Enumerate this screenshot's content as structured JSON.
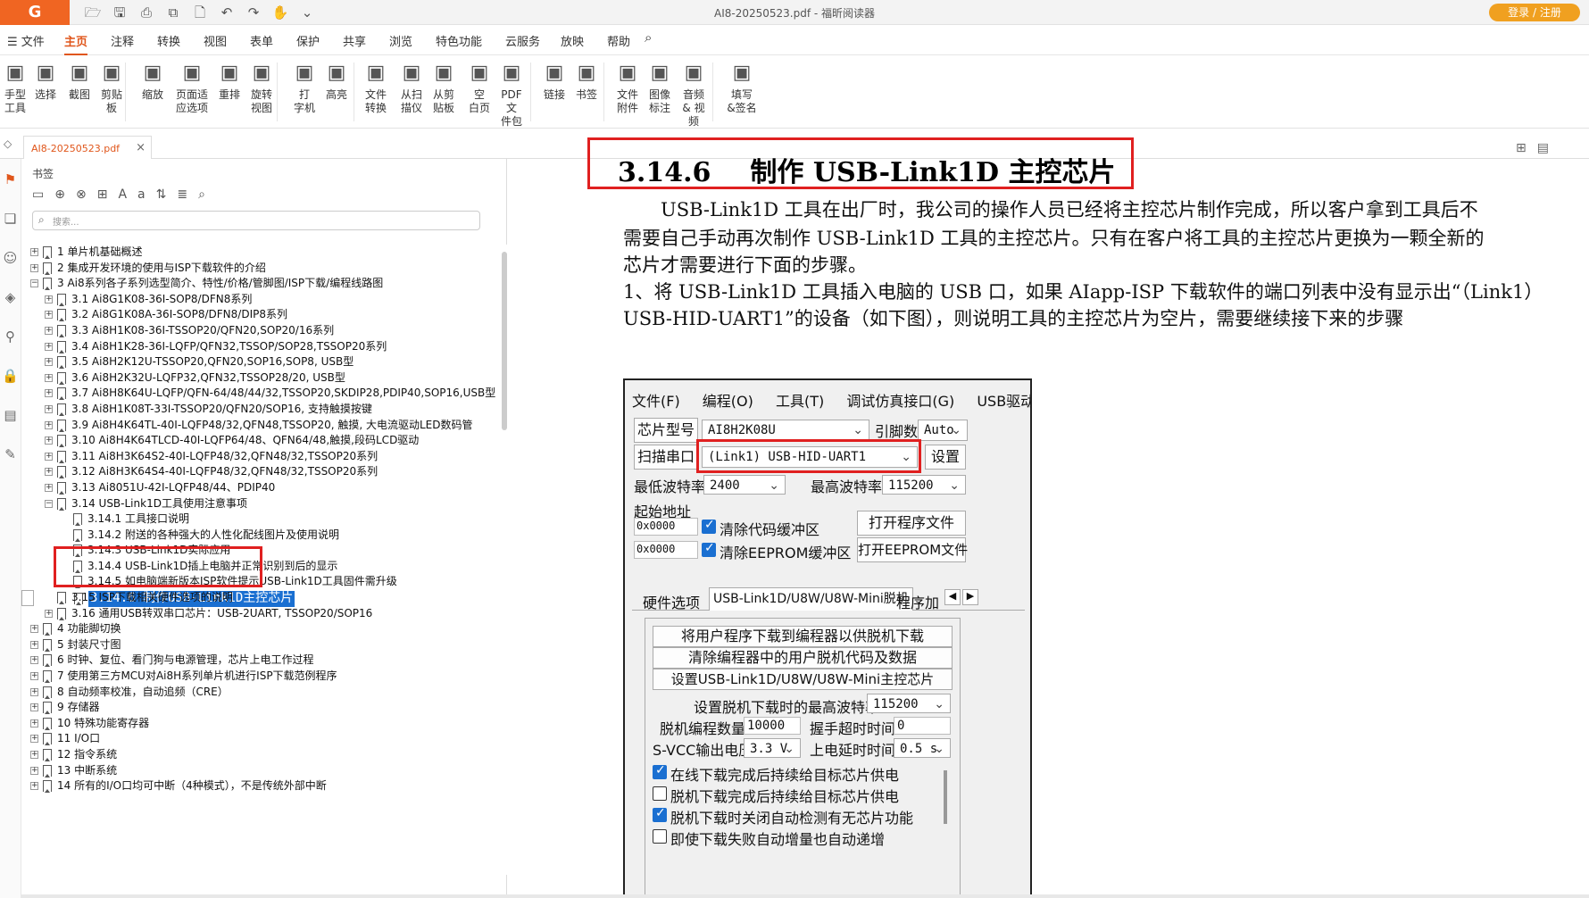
{
  "app": {
    "window_title": "AI8-20250523.pdf - 福昕阅读器",
    "login_label": "登录 / 注册",
    "logo": "G"
  },
  "menubar": {
    "file": "文件",
    "tabs": [
      "主页",
      "注释",
      "转换",
      "视图",
      "表单",
      "保护",
      "共享",
      "浏览",
      "特色功能",
      "云服务",
      "放映",
      "帮助"
    ]
  },
  "ribbon": {
    "tools": [
      {
        "label": "手型\n工具",
        "icon": "hand-icon"
      },
      {
        "label": "选择",
        "icon": "select-text-icon"
      },
      {
        "label": "截图",
        "icon": "screenshot-icon"
      },
      {
        "label": "剪贴\n板",
        "icon": "clipboard-icon"
      },
      {
        "label": "缩放",
        "icon": "zoom-icon"
      },
      {
        "label": "页面适\n应选项",
        "icon": "fit-page-icon"
      },
      {
        "label": "重排",
        "icon": "reflow-icon"
      },
      {
        "label": "旋转\n视图",
        "icon": "rotate-icon"
      },
      {
        "label": "打\n字机",
        "icon": "typewriter-icon"
      },
      {
        "label": "高亮",
        "icon": "highlight-icon"
      },
      {
        "label": "文件\n转换",
        "icon": "convert-icon"
      },
      {
        "label": "从扫\n描仪",
        "icon": "scanner-icon"
      },
      {
        "label": "从剪\n贴板",
        "icon": "from-clipboard-icon"
      },
      {
        "label": "空\n白页",
        "icon": "blank-page-icon"
      },
      {
        "label": "PDF文\n件包",
        "icon": "pdf-package-icon"
      },
      {
        "label": "链接",
        "icon": "link-icon"
      },
      {
        "label": "书签",
        "icon": "bookmark-icon"
      },
      {
        "label": "文件\n附件",
        "icon": "attachment-icon"
      },
      {
        "label": "图像\n标注",
        "icon": "image-annotation-icon"
      },
      {
        "label": "音频\n& 视频",
        "icon": "av-icon"
      },
      {
        "label": "填写\n&签名",
        "icon": "sign-icon"
      }
    ]
  },
  "tab": {
    "name": "AI8-20250523.pdf",
    "close": "×"
  },
  "bookmarks": {
    "title": "书签",
    "search_placeholder": "搜索...",
    "items": [
      {
        "level": 0,
        "expander": "+",
        "label": "1 单片机基础概述"
      },
      {
        "level": 0,
        "expander": "+",
        "label": "2 集成开发环境的使用与ISP下载软件的介绍"
      },
      {
        "level": 0,
        "expander": "−",
        "label": "3 Ai8系列各子系列选型简介、特性/价格/管脚图/ISP下载/编程线路图"
      },
      {
        "level": 1,
        "expander": "+",
        "label": "3.1 Ai8G1K08-36I-SOP8/DFN8系列"
      },
      {
        "level": 1,
        "expander": "+",
        "label": "3.2  Ai8G1K08A-36I-SOP8/DFN8/DIP8系列"
      },
      {
        "level": 1,
        "expander": "+",
        "label": "3.3 Ai8H1K08-36I-TSSOP20/QFN20,SOP20/16系列"
      },
      {
        "level": 1,
        "expander": "+",
        "label": "3.4 Ai8H1K28-36I-LQFP/QFN32,TSSOP/SOP28,TSSOP20系列"
      },
      {
        "level": 1,
        "expander": "+",
        "label": "3.5 Ai8H2K12U-TSSOP20,QFN20,SOP16,SOP8, USB型"
      },
      {
        "level": 1,
        "expander": "+",
        "label": "3.6 Ai8H2K32U-LQFP32,QFN32,TSSOP28/20, USB型"
      },
      {
        "level": 1,
        "expander": "+",
        "label": "3.7 Ai8H8K64U-LQFP/QFN-64/48/44/32,TSSOP20,SKDIP28,PDIP40,SOP16,USB型"
      },
      {
        "level": 1,
        "expander": "+",
        "label": "3.8 Ai8H1K08T-33I-TSSOP20/QFN20/SOP16, 支持触摸按键"
      },
      {
        "level": 1,
        "expander": "+",
        "label": "3.9  Ai8H4K64TL-40I-LQFP48/32,QFN48,TSSOP20, 触摸, 大电流驱动LED数码管"
      },
      {
        "level": 1,
        "expander": "+",
        "label": "3.10  Ai8H4K64TLCD-40I-LQFP64/48、QFN64/48,触摸,段码LCD驱动"
      },
      {
        "level": 1,
        "expander": "+",
        "label": "3.11  Ai8H3K64S2-40I-LQFP48/32,QFN48/32,TSSOP20系列"
      },
      {
        "level": 1,
        "expander": "+",
        "label": "3.12  Ai8H3K64S4-40I-LQFP48/32,QFN48/32,TSSOP20系列"
      },
      {
        "level": 1,
        "expander": "+",
        "label": "3.13  Ai8051U-42I-LQFP48/44、PDIP40"
      },
      {
        "level": 1,
        "expander": "−",
        "label": "3.14 USB-Link1D工具使用注意事项"
      },
      {
        "level": 2,
        "expander": "",
        "label": "3.14.1 工具接口说明"
      },
      {
        "level": 2,
        "expander": "",
        "label": "3.14.2  附送的各种强大的人性化配线图片及使用说明"
      },
      {
        "level": 2,
        "expander": "",
        "label": "3.14.3 USB-Link1D实际应用"
      },
      {
        "level": 2,
        "expander": "",
        "label": "3.14.4  USB-Link1D插上电脑并正常识别到后的显示"
      },
      {
        "level": 2,
        "expander": "",
        "label": "3.14.5  如电脑端新版本ISP软件提示USB-Link1D工具固件需升级"
      },
      {
        "level": 2,
        "expander": "",
        "label": "3.14.6  制作USB-Link1D主控芯片",
        "selected": true
      },
      {
        "level": 1,
        "expander": "",
        "label": "3.15  ISP下载相关硬件选项的说明"
      },
      {
        "level": 1,
        "expander": "+",
        "label": "3.16  通用USB转双串口芯片：USB-2UART, TSSOP20/SOP16"
      },
      {
        "level": 0,
        "expander": "+",
        "label": "4 功能脚切换"
      },
      {
        "level": 0,
        "expander": "+",
        "label": "5 封装尺寸图"
      },
      {
        "level": 0,
        "expander": "+",
        "label": "6 时钟、复位、看门狗与电源管理，芯片上电工作过程"
      },
      {
        "level": 0,
        "expander": "+",
        "label": "7 使用第三方MCU对Ai8H系列单片机进行ISP下载范例程序"
      },
      {
        "level": 0,
        "expander": "+",
        "label": "8 自动频率校准，自动追频（CRE）"
      },
      {
        "level": 0,
        "expander": "+",
        "label": "9 存储器"
      },
      {
        "level": 0,
        "expander": "+",
        "label": "10  特殊功能寄存器"
      },
      {
        "level": 0,
        "expander": "+",
        "label": "11  I/O口"
      },
      {
        "level": 0,
        "expander": "+",
        "label": "12  指令系统"
      },
      {
        "level": 0,
        "expander": "+",
        "label": "13  中断系统"
      },
      {
        "level": 0,
        "expander": "+",
        "label": "14  所有的I/O口均可中断（4种模式），不是传统外部中断"
      }
    ]
  },
  "document": {
    "section_number": "3.14.6",
    "section_title": "制作 USB-Link1D 主控芯片",
    "paragraph1_line1": "USB-Link1D 工具在出厂时，我公司的操作人员已经将主控芯片制作完成，所以客户拿到工具后不",
    "paragraph1_line2": "需要自己手动再次制作 USB-Link1D 工具的主控芯片。只有在客户将工具的主控芯片更换为一颗全新的",
    "paragraph1_line3": "芯片才需要进行下面的步骤。",
    "paragraph2_line1": "1、将 USB-Link1D 工具插入电脑的 USB 口，如果 AIapp-ISP 下载软件的端口列表中没有显示出“（Link1）",
    "paragraph2_line2": "USB-HID-UART1”的设备（如下图），则说明工具的主控芯片为空片，需要继续接下来的步骤"
  },
  "dialog": {
    "menu": [
      "文件(F)",
      "编程(O)",
      "工具(T)",
      "调试仿真接口(G)",
      "USB驱动安"
    ],
    "chip_model_label": "芯片型号",
    "chip_model_value": "AI8H2K08U",
    "pins_label": "引脚数",
    "pins_value": "Auto",
    "scan_port_label": "扫描串口",
    "port_value": "(Link1) USB-HID-UART1",
    "settings_button": "设置",
    "min_baud_label": "最低波特率",
    "min_baud_value": "2400",
    "max_baud_label": "最高波特率",
    "max_baud_value": "115200",
    "start_addr_label": "起始地址",
    "addr1": "0x0000",
    "addr2": "0x0000",
    "clear_code_label": "清除代码缓冲区",
    "clear_eeprom_label": "清除EEPROM缓冲区",
    "open_prog_button": "打开程序文件",
    "open_eeprom_button": "打开EEPROM文件",
    "tabs": [
      "硬件选项",
      "USB-Link1D/U8W/U8W-Mini脱机",
      "程序加"
    ],
    "btn_download": "将用户程序下载到编程器以供脱机下载",
    "btn_clear": "清除编程器中的用户脱机代码及数据",
    "btn_setup": "设置USB-Link1D/U8W/U8W-Mini主控芯片",
    "max_baud_offline_label": "设置脱机下载时的最高波特率",
    "max_baud_offline_value": "115200",
    "count_label": "脱机编程数量",
    "count_value": "10000",
    "handshake_label": "握手超时时间",
    "handshake_value": "0",
    "svcc_label": "S-VCC输出电压",
    "svcc_value": "3.3 V",
    "delay_label": "上电延时时间",
    "delay_value": "0.5 s",
    "check1": "在线下载完成后持续给目标芯片供电",
    "check2": "脱机下载完成后持续给目标芯片供电",
    "check3": "脱机下载时关闭自动检测有无芯片功能",
    "check4": "即使下载失败自动增量也自动递增"
  },
  "colors": {
    "accent": "#e0561b",
    "highlight_box": "#e02020",
    "selection": "#1a6fd1"
  }
}
